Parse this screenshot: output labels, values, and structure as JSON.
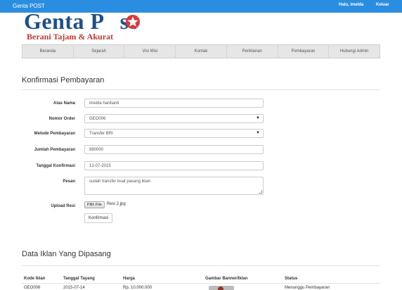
{
  "topbar": {
    "brand": "Genta POST",
    "greeting": "Halo, imelda",
    "logout": "Keluar"
  },
  "logo": {
    "line1_left": "Genta P",
    "line1_right": "st",
    "line2": "Berani Tajam & Akurat"
  },
  "nav": [
    "Beranda",
    "Sejarah",
    "Visi Misi",
    "Kontak",
    "Periklanan",
    "Pembayaran",
    "Hubungi Admin"
  ],
  "form": {
    "title": "Konfirmasi Pembayaran",
    "atas_nama": {
      "label": "Atas Nama",
      "value": "imelda hardianti"
    },
    "nomor_order": {
      "label": "Nomor Order",
      "value": "GEO006"
    },
    "metode": {
      "label": "Metode Pembayaran",
      "value": "Transfer BRI"
    },
    "jumlah": {
      "label": "Jumlah Pembayaran",
      "value": "880000"
    },
    "tanggal": {
      "label": "Tanggal Konfirmasi",
      "value": "12-07-2015"
    },
    "pesan": {
      "label": "Pesan",
      "value": "sudah transfer buat pasang iklan"
    },
    "upload": {
      "label": "Upload Resi",
      "button": "Pilih File",
      "filename": "Resi 2.jpg"
    },
    "submit": "Konfirmasi"
  },
  "table": {
    "title": "Data Iklan Yang Dipasang",
    "headers": [
      "Kode Iklan",
      "Tanggal Tayang",
      "Harga",
      "Gambar Banner/Iklan",
      "Status"
    ],
    "row": [
      "GEO006",
      "2015-07-14",
      "Rp. 10.000.000",
      "",
      "Menunggu Pembayaran"
    ]
  },
  "colors": {
    "topbar": "#2a8ee0",
    "logo_blue": "#1f4f8a",
    "logo_red": "#c0392b",
    "logo_star": "#d93a3a"
  },
  "icons": {
    "logo_star": "star-o-icon",
    "select_caret": "caret-down-icon",
    "resize": "resize-grip-icon"
  }
}
